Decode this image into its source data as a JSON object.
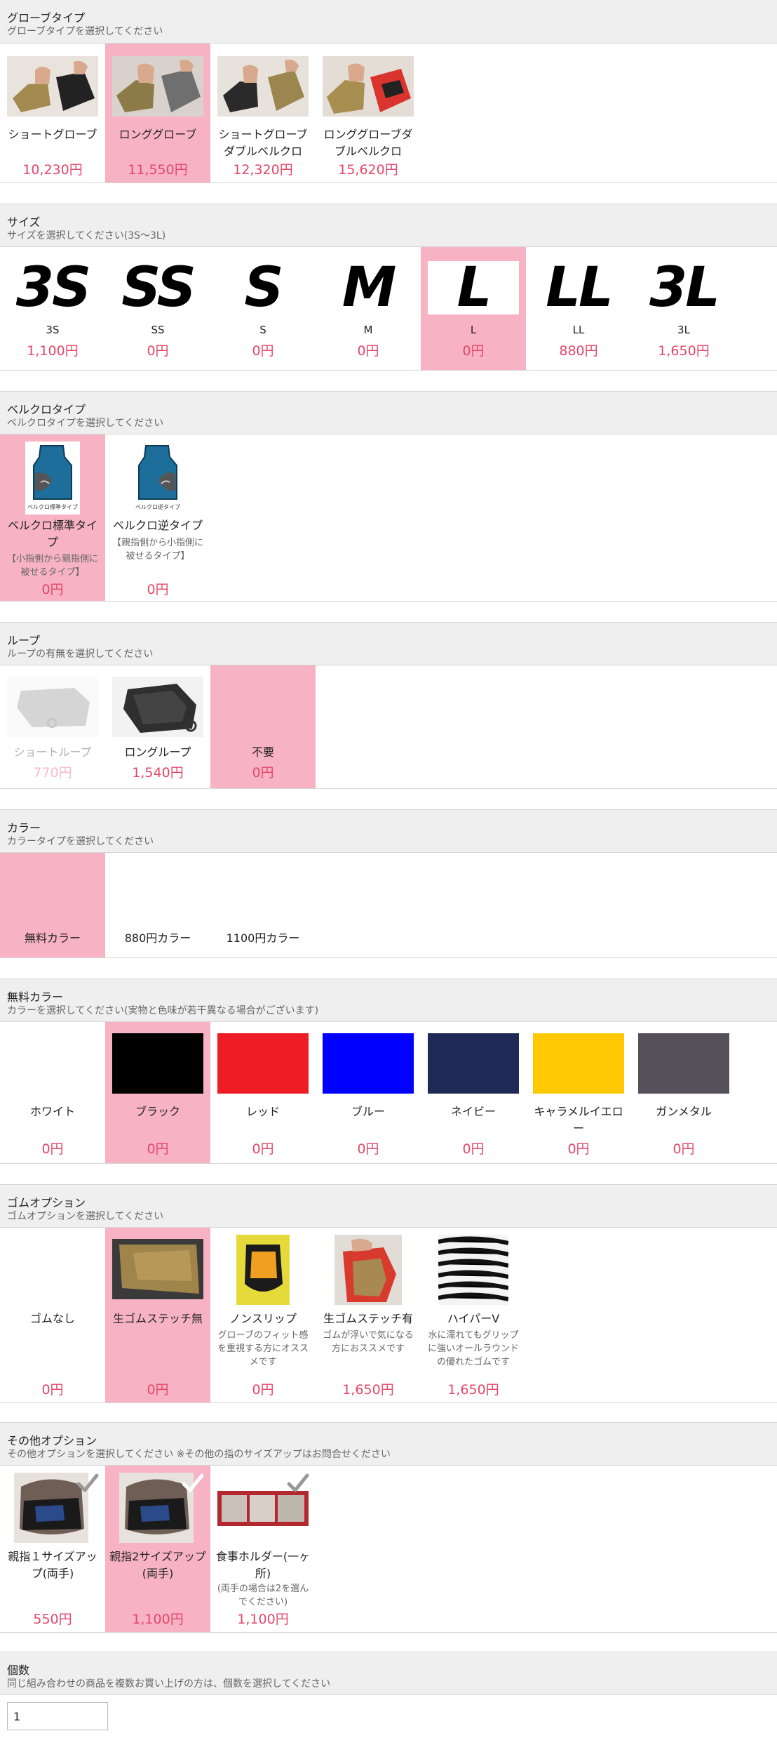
{
  "glove_type": {
    "title": "グローブタイプ",
    "subtitle": "グローブタイプを選択してください",
    "options": [
      {
        "label": "ショートグローブ",
        "price": "10,230円"
      },
      {
        "label": "ロンググローブ",
        "price": "11,550円"
      },
      {
        "label": "ショートグローブダブルベルクロ",
        "price": "12,320円"
      },
      {
        "label": "ロンググローブダブルベルクロ",
        "price": "15,620円"
      }
    ]
  },
  "size": {
    "title": "サイズ",
    "subtitle": "サイズを選択してください(3S〜3L)",
    "options": [
      {
        "glyph": "3S",
        "label": "3S",
        "price": "1,100円"
      },
      {
        "glyph": "SS",
        "label": "SS",
        "price": "0円"
      },
      {
        "glyph": "S",
        "label": "S",
        "price": "0円"
      },
      {
        "glyph": "M",
        "label": "M",
        "price": "0円"
      },
      {
        "glyph": "L",
        "label": "L",
        "price": "0円"
      },
      {
        "glyph": "LL",
        "label": "LL",
        "price": "880円"
      },
      {
        "glyph": "3L",
        "label": "3L",
        "price": "1,650円"
      }
    ]
  },
  "velcro": {
    "title": "ベルクロタイプ",
    "subtitle": "ベルクロタイプを選択してください",
    "options": [
      {
        "label": "ベルクロ標準タイプ",
        "desc": "【小指側から親指側に被せるタイプ】",
        "price": "0円",
        "image_caption": "ベルクロ標準タイプ"
      },
      {
        "label": "ベルクロ逆タイプ",
        "desc": "【親指側から小指側に被せるタイプ】",
        "price": "0円",
        "image_caption": "ベルクロ逆タイプ"
      }
    ]
  },
  "loop": {
    "title": "ループ",
    "subtitle": "ループの有無を選択してください",
    "options": [
      {
        "label": "ショートループ",
        "price": "770円"
      },
      {
        "label": "ロングループ",
        "price": "1,540円"
      },
      {
        "label": "不要",
        "price": "0円"
      }
    ]
  },
  "color_type": {
    "title": "カラー",
    "subtitle": "カラータイプを選択してください",
    "options": [
      {
        "label": "無料カラー"
      },
      {
        "label": "880円カラー"
      },
      {
        "label": "1100円カラー"
      }
    ]
  },
  "free_color": {
    "title": "無料カラー",
    "subtitle": "カラーを選択してください(実物と色味が若干異なる場合がございます)",
    "options": [
      {
        "label": "ホワイト",
        "price": "0円",
        "color": "#ffffff"
      },
      {
        "label": "ブラック",
        "price": "0円",
        "color": "#000000"
      },
      {
        "label": "レッド",
        "price": "0円",
        "color": "#ee1c25"
      },
      {
        "label": "ブルー",
        "price": "0円",
        "color": "#0000ff"
      },
      {
        "label": "ネイビー",
        "price": "0円",
        "color": "#1e2a55"
      },
      {
        "label": "キャラメルイエロー",
        "price": "0円",
        "color": "#ffc800"
      },
      {
        "label": "ガンメタル",
        "price": "0円",
        "color": "#55505a"
      }
    ]
  },
  "rubber": {
    "title": "ゴムオプション",
    "subtitle": "ゴムオプションを選択してください",
    "options": [
      {
        "label": "ゴムなし",
        "desc": "",
        "price": "0円"
      },
      {
        "label": "生ゴムステッチ無",
        "desc": "",
        "price": "0円"
      },
      {
        "label": "ノンスリップ",
        "desc": "グローブのフィット感を重視する方にオススメです",
        "price": "0円"
      },
      {
        "label": "生ゴムステッチ有",
        "desc": "ゴムが浮いで気になる方におススメです",
        "price": "1,650円"
      },
      {
        "label": "ハイパーV",
        "desc": "水に濡れてもグリップに強いオールラウンドの優れたゴムです",
        "price": "1,650円"
      }
    ]
  },
  "other": {
    "title": "その他オプション",
    "subtitle": "その他オプションを選択してください ※その他の指のサイズアップはお問合せください",
    "options": [
      {
        "label": "親指１サイズアップ(両手)",
        "desc": "",
        "price": "550円"
      },
      {
        "label": "親指2サイズアップ(両手)",
        "desc": "",
        "price": "1,100円"
      },
      {
        "label": "食事ホルダー(一ヶ所)",
        "desc": "(両手の場合は2を選んでください)",
        "price": "1,100円"
      }
    ]
  },
  "quantity": {
    "title": "個数",
    "subtitle": "同じ組み合わせの商品を複数お買い上げの方は、個数を選択してください",
    "value": "1"
  },
  "colors": {
    "accent": "#f7b3c4",
    "price": "#e4476a"
  }
}
